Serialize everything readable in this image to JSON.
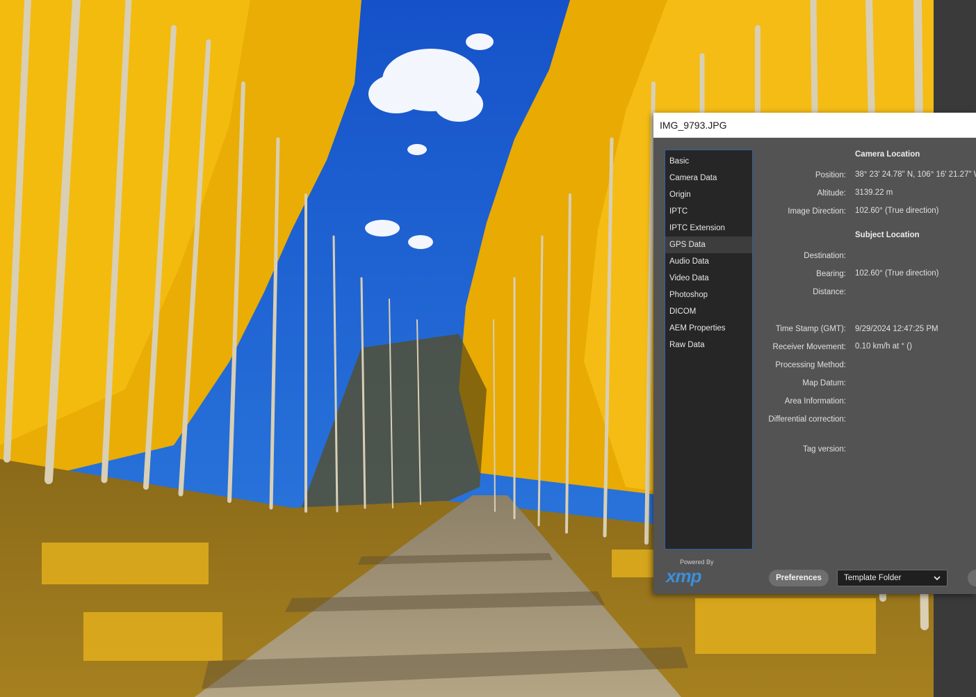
{
  "dialog": {
    "title": "IMG_9793.JPG",
    "categories": [
      "Basic",
      "Camera Data",
      "Origin",
      "IPTC",
      "IPTC Extension",
      "GPS Data",
      "Audio Data",
      "Video Data",
      "Photoshop",
      "DICOM",
      "AEM Properties",
      "Raw Data"
    ],
    "selected_category": "GPS Data",
    "camera_location": {
      "heading": "Camera Location",
      "position_label": "Position:",
      "position_value": "38° 23' 24.78\" N,  106° 16' 21.27\" W",
      "altitude_label": "Altitude:",
      "altitude_value": "3139.22 m",
      "image_direction_label": "Image Direction:",
      "image_direction_value": "102.60° (True direction)"
    },
    "subject_location": {
      "heading": "Subject Location",
      "destination_label": "Destination:",
      "destination_value": "",
      "bearing_label": "Bearing:",
      "bearing_value": "102.60° (True direction)",
      "distance_label": "Distance:",
      "distance_value": ""
    },
    "other": {
      "timestamp_label": "Time Stamp (GMT):",
      "timestamp_value": "9/29/2024 12:47:25 PM",
      "receiver_movement_label": "Receiver Movement:",
      "receiver_movement_value": "0.10 km/h at ° ()",
      "processing_method_label": "Processing Method:",
      "map_datum_label": "Map Datum:",
      "area_information_label": "Area Information:",
      "differential_correction_label": "Differential correction:",
      "tag_version_label": "Tag version:"
    },
    "footer": {
      "powered_by": "Powered By",
      "logo_text": "xmp",
      "preferences_label": "Preferences",
      "template_folder_label": "Template Folder"
    }
  },
  "colors": {
    "dialog_bg": "#535353",
    "list_bg": "#262626",
    "list_border": "#2d5fa8",
    "xmp_blue": "#3b8fd9",
    "foliage": "#f2b400",
    "sky": "#1b63d8"
  },
  "icons": [
    "chevron-down-icon"
  ]
}
